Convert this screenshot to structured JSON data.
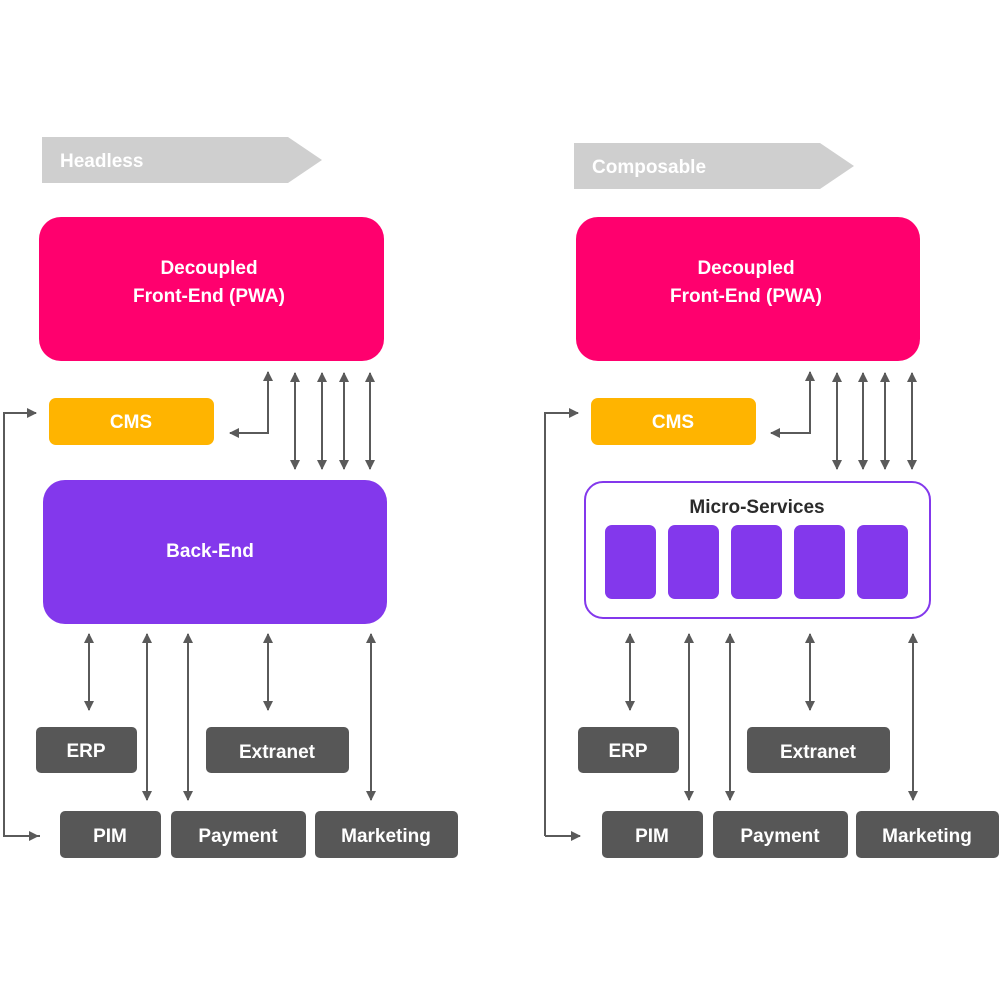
{
  "colors": {
    "banner": "#cfcfcf",
    "frontend": "#ff006e",
    "cms": "#ffb400",
    "backend": "#8338ec",
    "system": "#575757",
    "arrow": "#5a5a5a"
  },
  "headless": {
    "banner": "Headless",
    "frontend_line1": "Decoupled",
    "frontend_line2": "Front-End (PWA)",
    "cms": "CMS",
    "backend": "Back-End",
    "systems": {
      "erp": "ERP",
      "extranet": "Extranet",
      "pim": "PIM",
      "payment": "Payment",
      "marketing": "Marketing"
    }
  },
  "composable": {
    "banner": "Composable",
    "frontend_line1": "Decoupled",
    "frontend_line2": "Front-End (PWA)",
    "cms": "CMS",
    "microservices_title": "Micro-Services",
    "microservice_count": 5,
    "systems": {
      "erp": "ERP",
      "extranet": "Extranet",
      "pim": "PIM",
      "payment": "Payment",
      "marketing": "Marketing"
    }
  }
}
